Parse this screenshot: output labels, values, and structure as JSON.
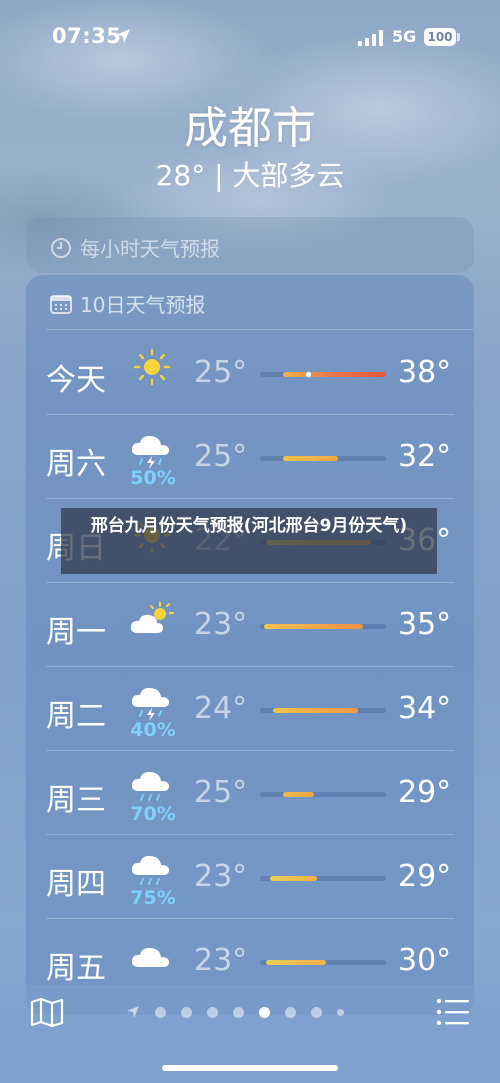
{
  "status": {
    "time": "07:35",
    "network": "5G",
    "battery": "100"
  },
  "location": {
    "city": "成都市",
    "summary": "28° | 大部多云"
  },
  "hourly": {
    "title": "每小时天气预报"
  },
  "daily": {
    "title": "10日天气预报",
    "days": [
      {
        "day": "今天",
        "icon": "sun-icon",
        "pop": "",
        "low": "25°",
        "high": "38°",
        "range": [
          0.18,
          1.0
        ],
        "current": 0.38,
        "gradient": "linear-gradient(90deg,#f0b24a,#e8744a,#e05a45)"
      },
      {
        "day": "周六",
        "icon": "thunderstorm-icon",
        "pop": "50%",
        "low": "25°",
        "high": "32°",
        "range": [
          0.18,
          0.62
        ],
        "current": null,
        "gradient": "linear-gradient(90deg,#f3c24a,#f0a645)"
      },
      {
        "day": "周日",
        "icon": "sun-icon",
        "pop": "",
        "low": "22°",
        "high": "36°",
        "range": [
          0.05,
          0.88
        ],
        "current": null,
        "gradient": "linear-gradient(90deg,#e5cf5a,#ef9a45)"
      },
      {
        "day": "周一",
        "icon": "partly-cloudy-icon",
        "pop": "",
        "low": "23°",
        "high": "35°",
        "range": [
          0.03,
          0.82
        ],
        "current": null,
        "gradient": "linear-gradient(90deg,#f2c34d,#ee9145)"
      },
      {
        "day": "周二",
        "icon": "thunderstorm-icon",
        "pop": "40%",
        "low": "24°",
        "high": "34°",
        "range": [
          0.1,
          0.78
        ],
        "current": null,
        "gradient": "linear-gradient(90deg,#f2c34d,#f09848)"
      },
      {
        "day": "周三",
        "icon": "rain-icon",
        "pop": "70%",
        "low": "25°",
        "high": "29°",
        "range": [
          0.18,
          0.43
        ],
        "current": null,
        "gradient": "linear-gradient(90deg,#f0b94a,#efa444)"
      },
      {
        "day": "周四",
        "icon": "rain-icon",
        "pop": "75%",
        "low": "23°",
        "high": "29°",
        "range": [
          0.08,
          0.45
        ],
        "current": null,
        "gradient": "linear-gradient(90deg,#e8cf5a,#f2b048)"
      },
      {
        "day": "周五",
        "icon": "cloud-icon",
        "pop": "",
        "low": "23°",
        "high": "30°",
        "range": [
          0.05,
          0.52
        ],
        "current": null,
        "gradient": "linear-gradient(90deg,#e8cf5a,#f2b048)"
      }
    ]
  },
  "overlay": {
    "text": "邢台九月份天气预报(河北邢台9月份天气)"
  },
  "pager": {
    "pages": 9,
    "active": 5
  }
}
